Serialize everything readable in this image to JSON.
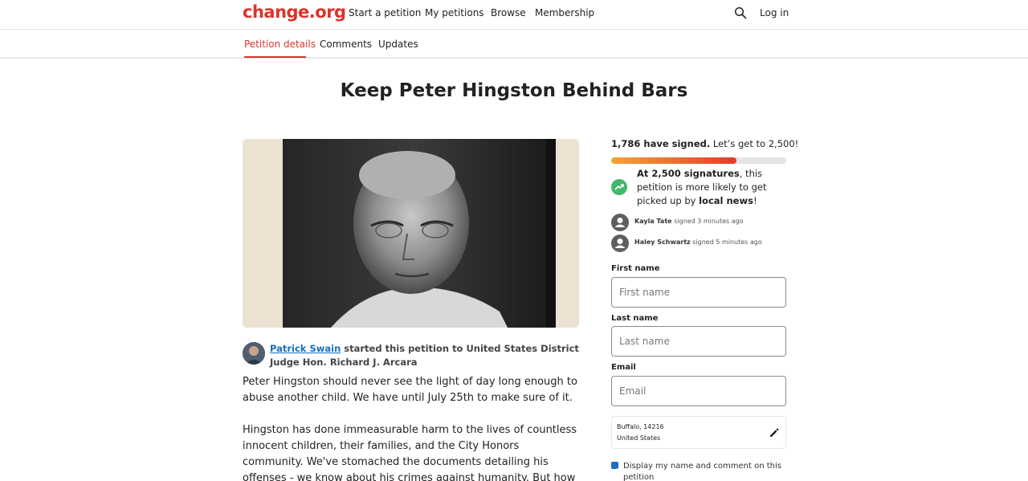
{
  "header": {
    "logo": "change.org",
    "nav": [
      "Start a petition",
      "My petitions",
      "Browse",
      "Membership"
    ],
    "login": "Log in",
    "search_icon": "search-icon"
  },
  "tabs": [
    "Petition details",
    "Comments",
    "Updates"
  ],
  "petition": {
    "title": "Keep Peter Hingston Behind Bars",
    "starter_name": "Patrick Swain",
    "starter_rest": "started this petition to United States District Judge Hon. Richard J. Arcara",
    "paragraphs": [
      "Peter Hingston should never see the light of day long enough to abuse another child. We have until July 25th to make sure of it.",
      "Hingston has done immeasurable harm to the lives of countless innocent children, their families, and the City Honors community. We've stomached the documents detailing his offenses - we know about his crimes against humanity. But how many more went"
    ]
  },
  "sidebar": {
    "signed_count": "1,786 have signed.",
    "signed_goal": "Let’s get to 2,500!",
    "progress_fraction": 0.714,
    "goal_bold": "At 2,500 signatures",
    "goal_mid": ", this petition is more likely to get picked up by ",
    "goal_bold2": "local news",
    "goal_end": "!",
    "signers": [
      {
        "name": "Kayla Tate",
        "time": "signed 3 minutes ago"
      },
      {
        "name": "Haley Schwartz",
        "time": "signed 5 minutes ago"
      }
    ],
    "form": {
      "first_label": "First name",
      "first_placeholder": "First name",
      "last_label": "Last name",
      "last_placeholder": "Last name",
      "email_label": "Email",
      "email_placeholder": "Email"
    },
    "location": {
      "line1": "Buffalo, 14216",
      "line2": "United States"
    },
    "display_checkbox": "Display my name and comment on this petition"
  },
  "colors": {
    "brand": "#e0312b",
    "link": "#1a6fbf",
    "success": "#3fb86a"
  }
}
